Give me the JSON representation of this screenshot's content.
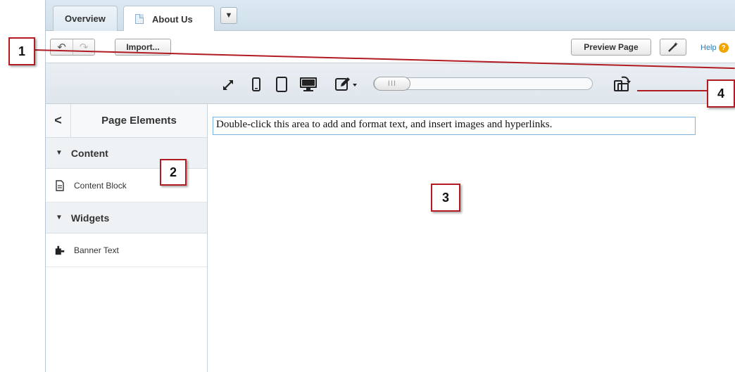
{
  "tabs": {
    "items": [
      {
        "label": "Overview"
      },
      {
        "label": "About Us"
      }
    ],
    "more_symbol": "▼"
  },
  "toolbar": {
    "undo_icon": "↶",
    "redo_icon": "↷",
    "import_label": "Import...",
    "preview_label": "Preview Page",
    "magic_icon": "wand-icon",
    "help_label": "Help",
    "help_icon": "?"
  },
  "device_bar": {
    "icons": [
      "expand-icon",
      "phone-icon",
      "tablet-icon",
      "desktop-icon",
      "edit-dropdown-icon",
      "rotate-icon"
    ],
    "slider_thumb": "III"
  },
  "sidebar": {
    "back_symbol": "<",
    "title": "Page Elements",
    "sections": [
      {
        "label": "Content",
        "items": [
          {
            "label": "Content Block",
            "icon": "document-icon"
          }
        ]
      },
      {
        "label": "Widgets",
        "items": [
          {
            "label": "Banner Text",
            "icon": "widget-icon"
          }
        ]
      }
    ]
  },
  "canvas": {
    "text": "Double-click this area to add and format text, and insert images and hyperlinks."
  },
  "callouts": {
    "c1": "1",
    "c2": "2",
    "c3": "3",
    "c4": "4"
  },
  "colors": {
    "callout_border": "#b01c22",
    "tab_bg": "#dde9f2",
    "help_link": "#2a7ab0",
    "help_badge": "#f0a500"
  }
}
